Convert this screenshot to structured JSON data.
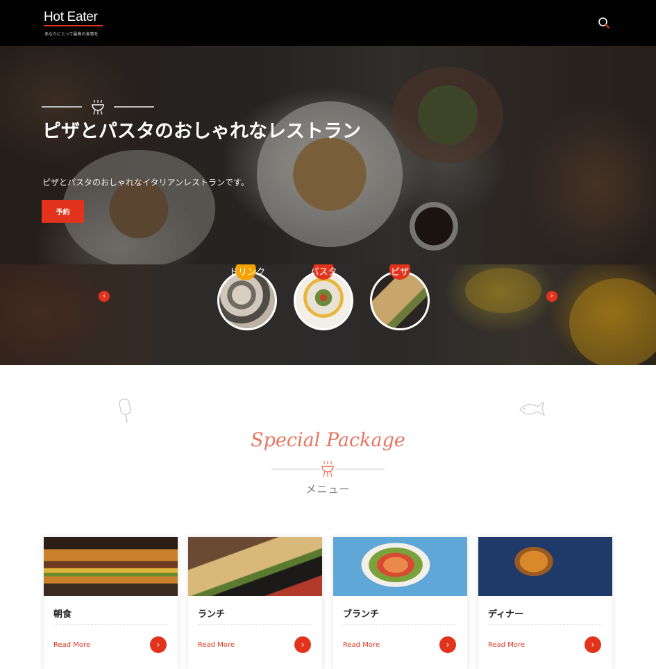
{
  "header": {
    "logo": "Hot Eater",
    "tagline": "あなたにとって最高の食事を",
    "accent_color": "#e2341d",
    "search_icon": "search-icon"
  },
  "hero": {
    "title": "ピザとパスタのおしゃれなレストラン",
    "subtitle": "ピザとパスタのおしゃれなイタリアンレストランです。",
    "button_label": "予約",
    "ornament_icon": "grill-icon"
  },
  "categories": {
    "prev_icon": "chevron-left-icon",
    "next_icon": "chevron-right-icon",
    "items": [
      {
        "label": "ドリンク",
        "badge_color": "#f5a100"
      },
      {
        "label": "パスタ",
        "badge_color": "#e2341d"
      },
      {
        "label": "ピザ",
        "badge_color": "#e2341d"
      }
    ]
  },
  "special": {
    "title": "Special Package",
    "subtitle": "メニュー",
    "ornament_icon": "grill-icon",
    "title_color": "#e8735f"
  },
  "cards": [
    {
      "title": "朝食",
      "link": "Read More"
    },
    {
      "title": "ランチ",
      "link": "Read More"
    },
    {
      "title": "ブランチ",
      "link": "Read More"
    },
    {
      "title": "ディナー",
      "link": "Read More"
    }
  ]
}
